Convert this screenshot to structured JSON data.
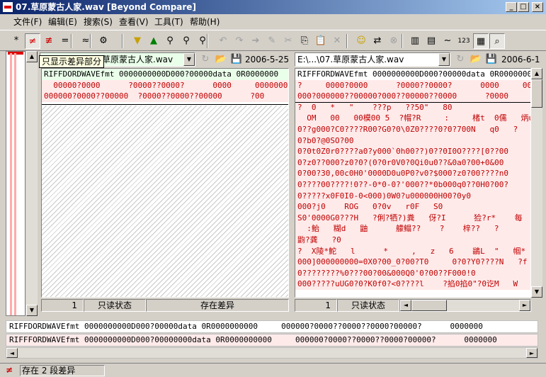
{
  "window": {
    "title": "07.草原蒙古人家.wav [Beyond Compare]",
    "min_glyph": "_",
    "max_glyph": "□",
    "close_glyph": "×"
  },
  "menu": [
    {
      "label": "文件(F)"
    },
    {
      "label": "编辑(E)"
    },
    {
      "label": "搜索(S)"
    },
    {
      "label": "查看(V)"
    },
    {
      "label": "工具(T)"
    },
    {
      "label": "帮助(H)"
    }
  ],
  "toolbar": {
    "tooltip": "只显示差异部分",
    "buttons": [
      {
        "name": "show-all-button",
        "glyph": "*",
        "state": "normal"
      },
      {
        "name": "show-differences-button",
        "glyph": "≠",
        "state": "pressed",
        "color": "#d00000"
      },
      {
        "name": "show-diff-lines-button",
        "glyph": "≢",
        "state": "normal",
        "color": "#d00000"
      },
      {
        "name": "show-same-button",
        "glyph": "=",
        "state": "normal"
      },
      {
        "name": "show-similar-button",
        "glyph": "≈",
        "state": "normal"
      },
      {
        "name": "rules-button",
        "glyph": "⚙",
        "state": "normal"
      },
      {
        "name": "next-diff-button",
        "glyph": "▼",
        "state": "normal",
        "color": "#c8a000"
      },
      {
        "name": "prev-diff-button",
        "glyph": "▲",
        "state": "normal",
        "color": "#008000"
      },
      {
        "name": "find-button",
        "glyph": "⚲",
        "state": "normal"
      },
      {
        "name": "find-next-button",
        "glyph": "⚲",
        "state": "normal"
      },
      {
        "name": "find-prev-button",
        "glyph": "⚲",
        "state": "normal"
      },
      {
        "name": "undo-button",
        "glyph": "↶",
        "state": "disabled"
      },
      {
        "name": "redo-button",
        "glyph": "↷",
        "state": "disabled"
      },
      {
        "name": "copy-to-other-button",
        "glyph": "➔",
        "state": "disabled"
      },
      {
        "name": "edit-button",
        "glyph": "✎",
        "state": "disabled"
      },
      {
        "name": "cut-button",
        "glyph": "✂",
        "state": "disabled"
      },
      {
        "name": "copy-button",
        "glyph": "⎘",
        "state": "normal"
      },
      {
        "name": "paste-button",
        "glyph": "📋",
        "state": "disabled"
      },
      {
        "name": "delete-button",
        "glyph": "✕",
        "state": "disabled"
      },
      {
        "name": "home-button",
        "glyph": "☺",
        "state": "normal",
        "color": "#c8a000"
      },
      {
        "name": "swap-button",
        "glyph": "⇄",
        "state": "normal"
      },
      {
        "name": "stop-button",
        "glyph": "⊗",
        "state": "disabled"
      },
      {
        "name": "side-by-side-button",
        "glyph": "▥",
        "state": "normal"
      },
      {
        "name": "over-under-button",
        "glyph": "▤",
        "state": "normal"
      },
      {
        "name": "text-view-button",
        "glyph": "~",
        "state": "normal"
      },
      {
        "name": "number-view-button",
        "glyph": "123",
        "state": "normal"
      },
      {
        "name": "hex-view-button",
        "glyph": "▦",
        "state": "pressed"
      },
      {
        "name": "zoom-button",
        "glyph": "⌕",
        "state": "pressed"
      }
    ]
  },
  "left_file": {
    "path": "草原蒙古人家.wav",
    "date": "2006-5-25",
    "lines": [
      "RIFFDORDWAVEfmt 0000000000D000?00000data 0R0000000",
      "  00000?0000      ?0000??0000?      0000     0000000",
      "000000?0000??00000  ?0000??0000??00000      ?00"
    ],
    "status": {
      "line": "1",
      "mode": "只读状态",
      "diff": "存在差异"
    }
  },
  "right_file": {
    "path": "E:\\...\\07.草原蒙古人家.wav",
    "date": "2006-6-1",
    "lines": [
      "RIFFFORDWAVEfmt 0000000000D000?00000data 0R0000000",
      "?     0000?0000      ?0000??0000?      0000     000",
      "000?000000??00000?000??00000??0000      ?0000  ",
      "?  0   *   \"    ???p   ??50\"   80",
      "  OM   00   00模00 5  ?帽?R     :     楮t  0儒   炳u",
      "0??g000?C0????R00?G0?0\\0Z0????0?0?700N   q0   ?",
      "0?b0?@0SO?00",
      "0?0t0Z0r0????a0?y000`0h00??)0??0I0O????[0??00",
      "0?z0??000?z0?0?(0?0r0V0?0Qi0u0??&0a0?00+0&00",
      "0?00?30,00c0H0'0000D0u0P0?v0?$000?z0?00????n0",
      "0????00????!0??-0*0-0?'000??*0b000q0??0H0?00?",
      "0?????x0F0I0-0<000)0W0?u000000H00?0y0",
      "000?j0    ROG   0?0v   r0F   S0",
      "S0'0000G0???H   ?俐?牺?)粪   伢?I      猃?r*    每",
      "  :鲐   糊d   鼬      艨鳎??    ?    梓??   ?",
      "鼩?龚   ?0",
      "?  X陵*鮀   l      *     ,   z   6    鶲L  \"   帼*   B",
      "000]000000000=0X0?00_0?00?T0     0?0?Y0????N   ?f",
      "0????????%0???00?00&000Q0'0?00??F000!0",
      "000?????uUG0?0?K0f0?<0????l    ?掐0掐0\"?0讫M   W"
    ],
    "status": {
      "line": "1",
      "mode": "只读状态"
    }
  },
  "compare": {
    "line1": "RIFFDORDWAVEfmt 0000000000D000?00000data 0R0000000000     000000?0000??0000??0000?00000?      0000000",
    "line2": "RIFFFORDWAVEfmt 0000000000D000?00000000data 0R0000000000     000000?0000??0000??0000?00000?      0000000"
  },
  "statusbar": {
    "text": "存在 2 段差异"
  }
}
